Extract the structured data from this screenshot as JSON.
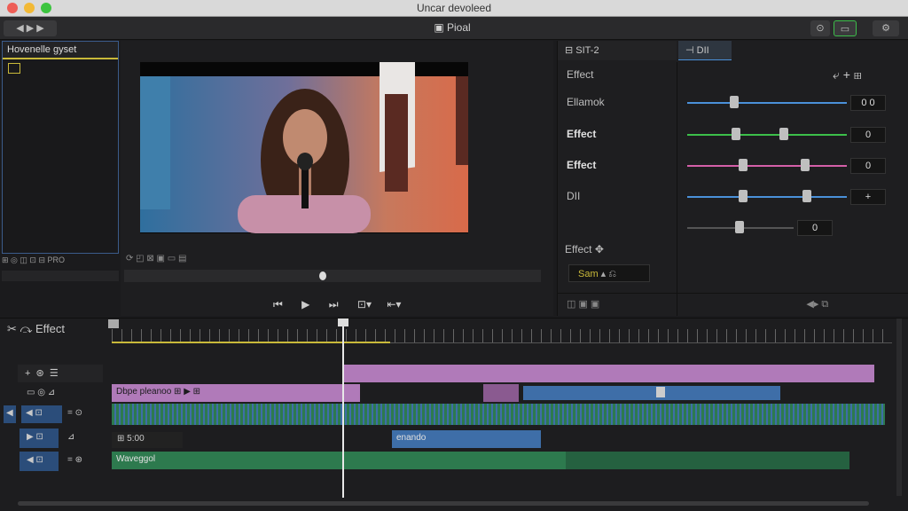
{
  "window": {
    "title": "Uncar devoleed"
  },
  "toolbar": {
    "viewer_title": "Pioal"
  },
  "browser": {
    "header": "Hovenelle gyset"
  },
  "viewer": {
    "timecode_labels": [
      "PRO"
    ]
  },
  "inspector": {
    "tab_a": "SIT-2",
    "tab_b": "DII",
    "section_label": "Effect",
    "rows": [
      {
        "label": "Ellamok",
        "value": "0 0",
        "color": "#4a90d9",
        "bold": false
      },
      {
        "label": "Effect",
        "value": "0",
        "color": "#3cbf4a",
        "bold": true
      },
      {
        "label": "Effect",
        "value": "0",
        "color": "#d45fa8",
        "bold": true
      },
      {
        "label": "DII",
        "value": "+",
        "color": "#4a90d9",
        "bold": false
      },
      {
        "label": "",
        "value": "0",
        "color": "#666666",
        "bold": false
      }
    ],
    "effect_label": "Effect",
    "sam_label": "Sam"
  },
  "timeline": {
    "effect_label": "Effect",
    "clips": {
      "title_clip": "Dbpe pleanoo",
      "value_label": "5:00",
      "blue_clip": "enando",
      "green_clip": "Waveggol"
    }
  },
  "colors": {
    "accent": "#c9b93a",
    "purple": "#b07ab9",
    "blue": "#3e6ea8",
    "green": "#2d7a4e"
  }
}
